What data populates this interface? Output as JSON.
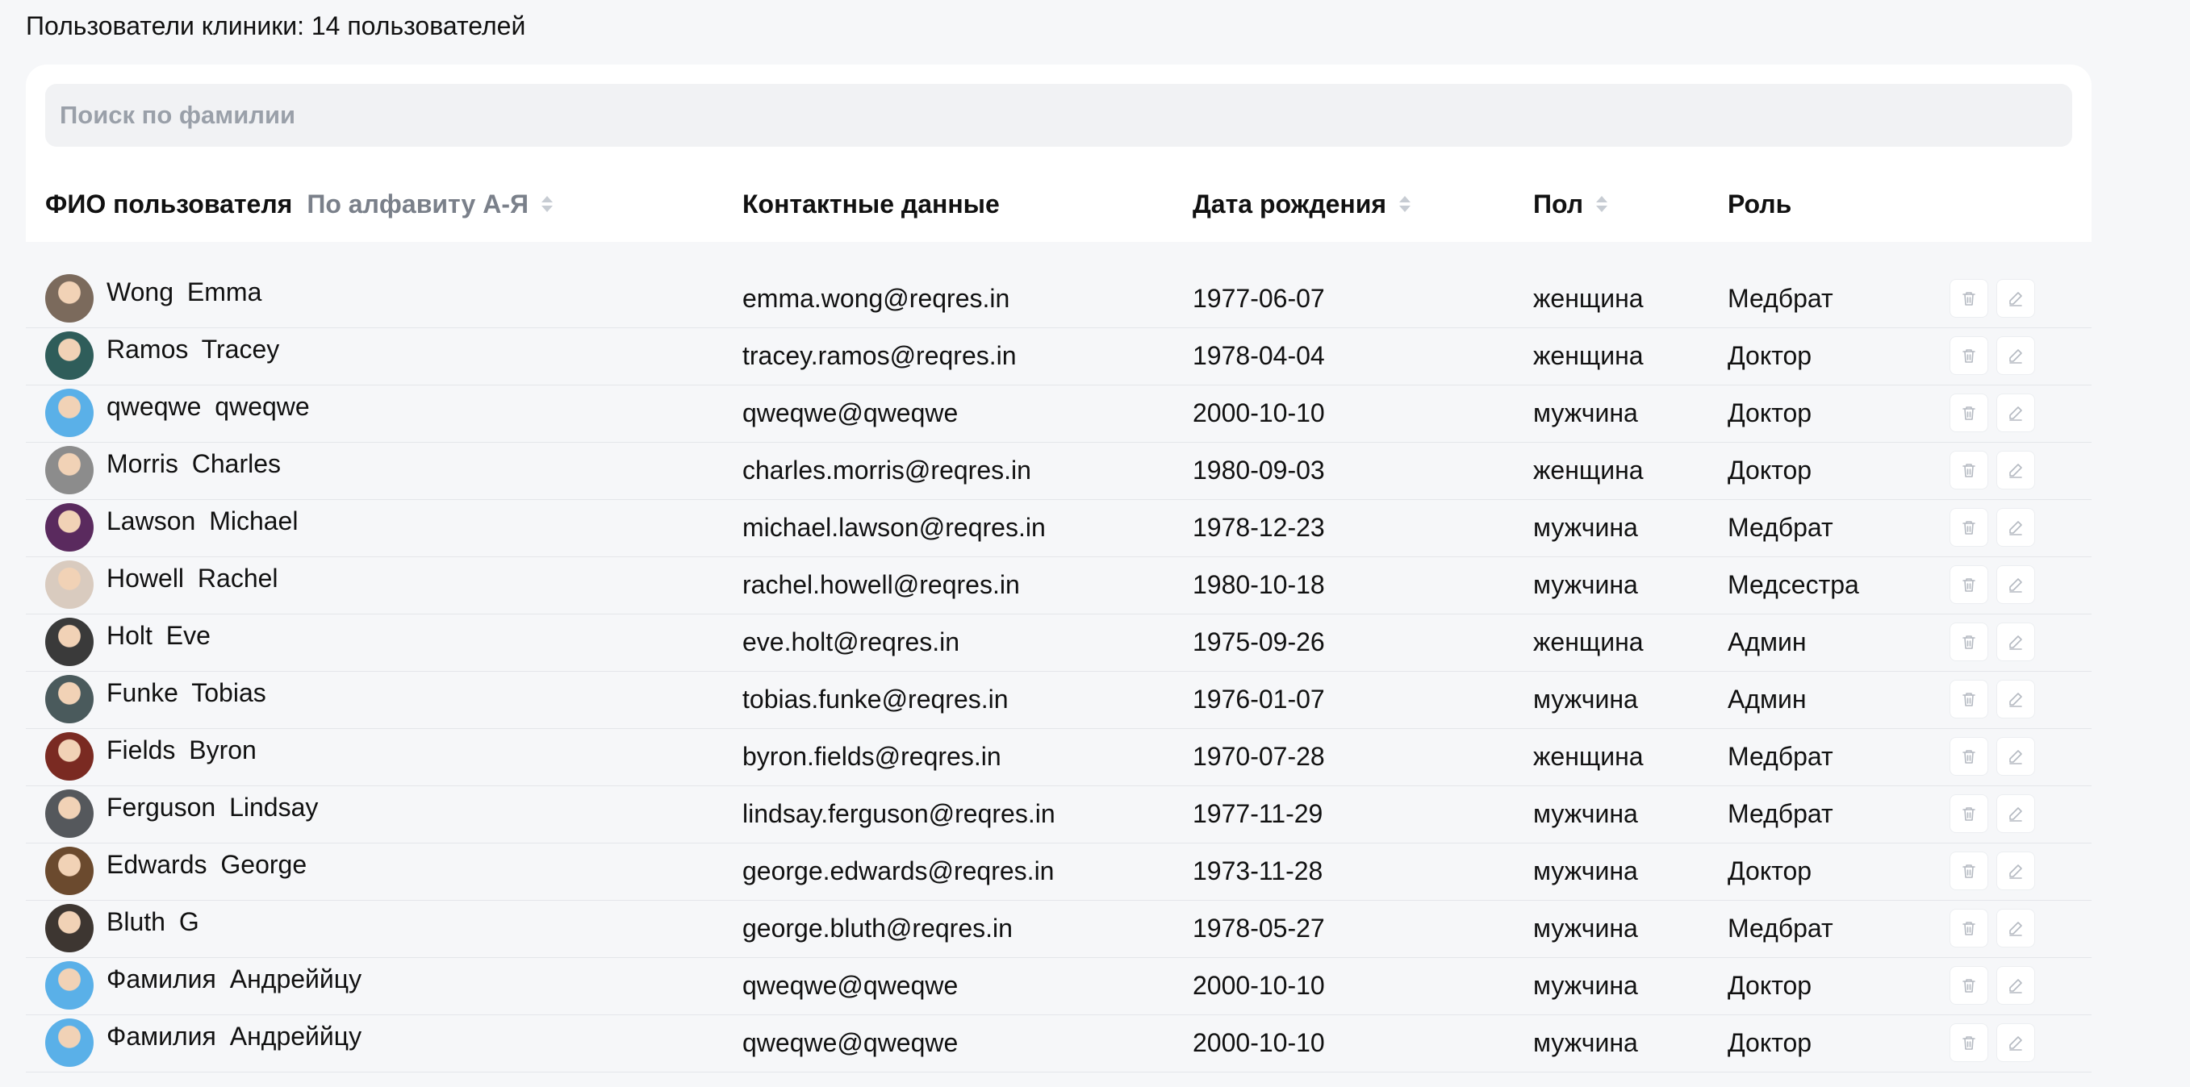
{
  "header": {
    "title": "Пользователи клиники: 14 пользователей"
  },
  "search": {
    "placeholder": "Поиск по фамилии"
  },
  "table": {
    "columns": {
      "name": "ФИО пользователя",
      "sort_label": "По алфавиту А-Я",
      "contacts": "Контактные данные",
      "dob": "Дата рождения",
      "sex": "Пол",
      "role": "Роль"
    },
    "rows": [
      {
        "name": "Wong  Emma",
        "email": "emma.wong@reqres.in",
        "dob": "1977-06-07",
        "sex": "женщина",
        "role": "Медбрат",
        "avatar": "#7b6a5c"
      },
      {
        "name": "Ramos  Tracey",
        "email": "tracey.ramos@reqres.in",
        "dob": "1978-04-04",
        "sex": "женщина",
        "role": "Доктор",
        "avatar": "#2f5d5a"
      },
      {
        "name": "qweqwe  qweqwe",
        "email": "qweqwe@qweqwe",
        "dob": "2000-10-10",
        "sex": "мужчина",
        "role": "Доктор",
        "avatar": "#5ab0e8"
      },
      {
        "name": "Morris  Charles",
        "email": "charles.morris@reqres.in",
        "dob": "1980-09-03",
        "sex": "женщина",
        "role": "Доктор",
        "avatar": "#8c8c8c"
      },
      {
        "name": "Lawson  Michael",
        "email": "michael.lawson@reqres.in",
        "dob": "1978-12-23",
        "sex": "мужчина",
        "role": "Медбрат",
        "avatar": "#5a2a5e"
      },
      {
        "name": "Howell  Rachel",
        "email": "rachel.howell@reqres.in",
        "dob": "1980-10-18",
        "sex": "мужчина",
        "role": "Медсестра",
        "avatar": "#d9cbbf"
      },
      {
        "name": "Holt  Eve",
        "email": "eve.holt@reqres.in",
        "dob": "1975-09-26",
        "sex": "женщина",
        "role": "Админ",
        "avatar": "#3a3a3a"
      },
      {
        "name": "Funke  Tobias",
        "email": "tobias.funke@reqres.in",
        "dob": "1976-01-07",
        "sex": "мужчина",
        "role": "Админ",
        "avatar": "#4a5a5c"
      },
      {
        "name": "Fields  Byron",
        "email": "byron.fields@reqres.in",
        "dob": "1970-07-28",
        "sex": "женщина",
        "role": "Медбрат",
        "avatar": "#7a2a22"
      },
      {
        "name": "Ferguson  Lindsay",
        "email": "lindsay.ferguson@reqres.in",
        "dob": "1977-11-29",
        "sex": "мужчина",
        "role": "Медбрат",
        "avatar": "#55585c"
      },
      {
        "name": "Edwards  George",
        "email": "george.edwards@reqres.in",
        "dob": "1973-11-28",
        "sex": "мужчина",
        "role": "Доктор",
        "avatar": "#6b4a2e"
      },
      {
        "name": "Bluth  G",
        "email": "george.bluth@reqres.in",
        "dob": "1978-05-27",
        "sex": "мужчина",
        "role": "Медбрат",
        "avatar": "#3d3631"
      },
      {
        "name": "Фамилия  Андреййцу",
        "email": "qweqwe@qweqwe",
        "dob": "2000-10-10",
        "sex": "мужчина",
        "role": "Доктор",
        "avatar": "#5ab0e8"
      },
      {
        "name": "Фамилия  Андреййцу",
        "email": "qweqwe@qweqwe",
        "dob": "2000-10-10",
        "sex": "мужчина",
        "role": "Доктор",
        "avatar": "#5ab0e8"
      }
    ],
    "actions": {
      "delete_icon": "trash-icon",
      "edit_icon": "pencil-icon"
    }
  }
}
